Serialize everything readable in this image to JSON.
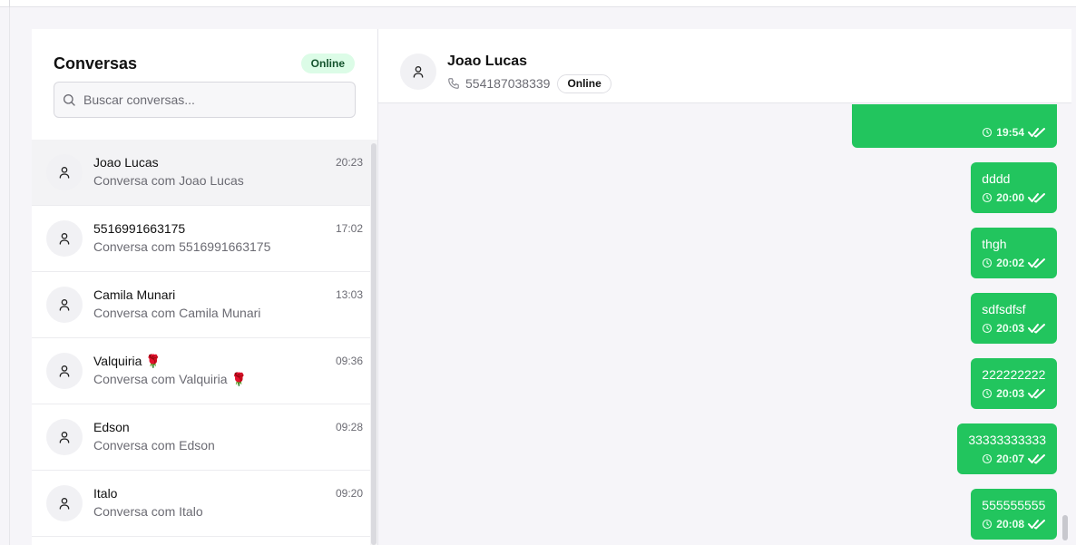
{
  "sidebar": {
    "title": "Conversas",
    "status_badge": "Online",
    "search_placeholder": "Buscar conversas...",
    "conversations": [
      {
        "name": "Joao Lucas",
        "preview": "Conversa com Joao Lucas",
        "time": "20:23",
        "active": true
      },
      {
        "name": "5516991663175",
        "preview": "Conversa com 5516991663175",
        "time": "17:02"
      },
      {
        "name": "Camila Munari",
        "preview": "Conversa com Camila Munari",
        "time": "13:03"
      },
      {
        "name": "Valquiria 🌹",
        "preview": "Conversa com Valquiria 🌹",
        "time": "09:36"
      },
      {
        "name": "Edson",
        "preview": "Conversa com Edson",
        "time": "09:28"
      },
      {
        "name": "Italo",
        "preview": "Conversa com Italo",
        "time": "09:20"
      }
    ]
  },
  "chat": {
    "contact_name": "Joao Lucas",
    "phone": "554187038339",
    "status": "Online",
    "messages": [
      {
        "text": "",
        "time": "19:54"
      },
      {
        "text": "dddd",
        "time": "20:00"
      },
      {
        "text": "thgh",
        "time": "20:02"
      },
      {
        "text": "sdfsdfsf",
        "time": "20:03"
      },
      {
        "text": "222222222",
        "time": "20:03"
      },
      {
        "text": "33333333333",
        "time": "20:07"
      },
      {
        "text": "555555555",
        "time": "20:08"
      }
    ]
  },
  "colors": {
    "accent": "#22c55e",
    "badge_bg": "#dcfce7",
    "badge_text": "#14532d"
  },
  "icons": {
    "search": "search-icon",
    "avatar": "user-icon",
    "phone": "phone-icon",
    "clock": "clock-icon",
    "read": "double-check-icon"
  }
}
